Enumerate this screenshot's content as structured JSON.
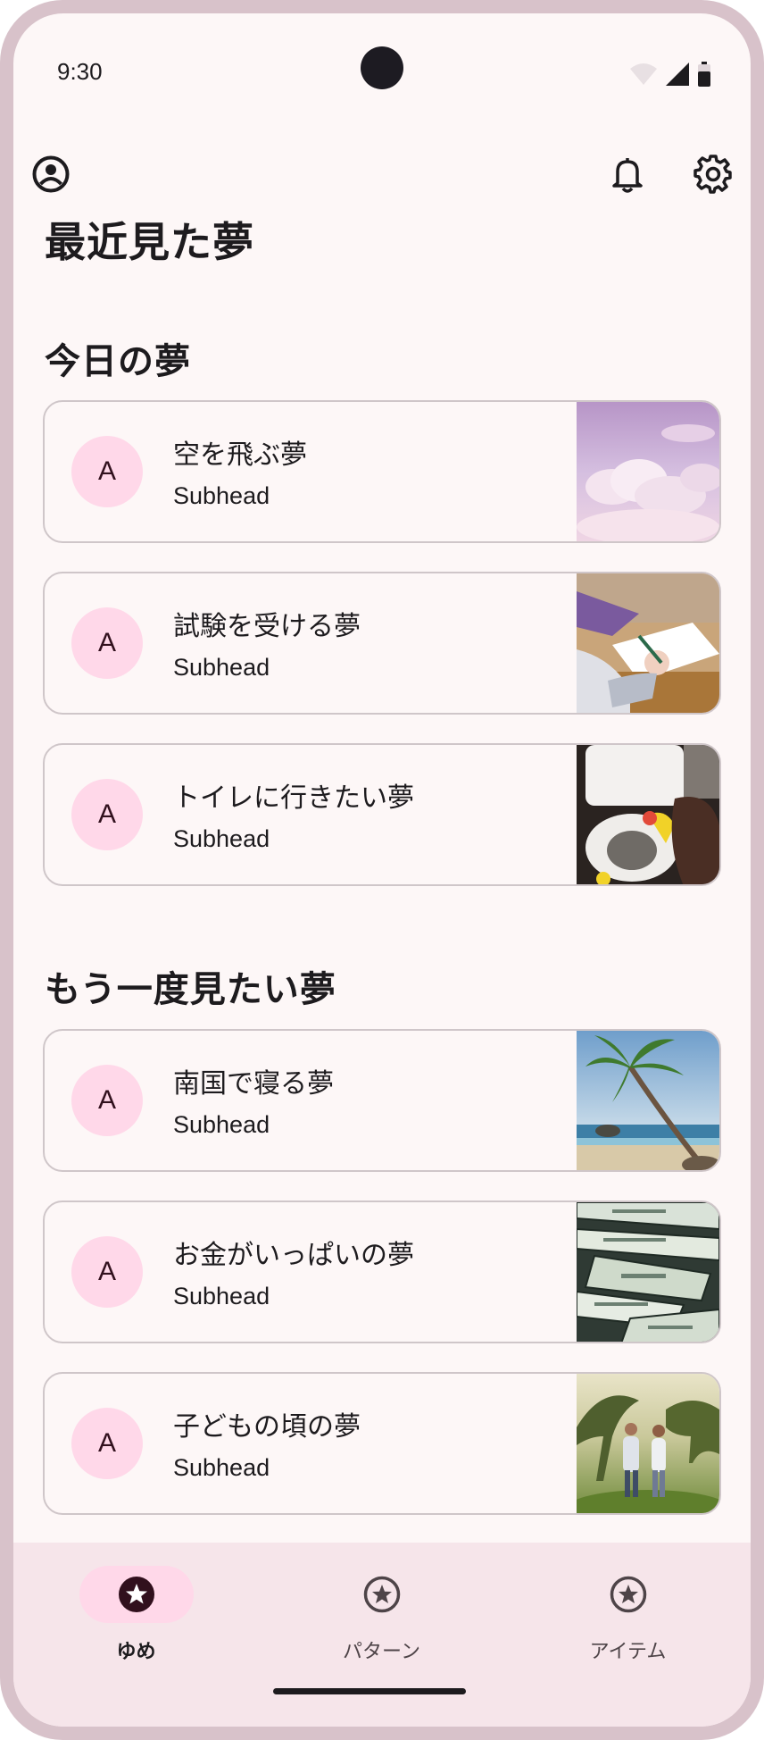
{
  "status_bar": {
    "time": "9:30"
  },
  "app_bar": {
    "account_icon": "account-circle-icon",
    "notifications_icon": "bell-icon",
    "settings_icon": "gear-icon"
  },
  "page_title": "最近見た夢",
  "sections": [
    {
      "title": "今日の夢",
      "items": [
        {
          "avatar": "A",
          "headline": "空を飛ぶ夢",
          "subhead": "Subhead",
          "image": "pink-clouds-sky"
        },
        {
          "avatar": "A",
          "headline": "試験を受ける夢",
          "subhead": "Subhead",
          "image": "person-writing-exam"
        },
        {
          "avatar": "A",
          "headline": "トイレに行きたい夢",
          "subhead": "Subhead",
          "image": "toilet-cleaning"
        }
      ]
    },
    {
      "title": "もう一度見たい夢",
      "items": [
        {
          "avatar": "A",
          "headline": "南国で寝る夢",
          "subhead": "Subhead",
          "image": "palm-tree-beach"
        },
        {
          "avatar": "A",
          "headline": "お金がいっぱいの夢",
          "subhead": "Subhead",
          "image": "dollar-bills"
        },
        {
          "avatar": "A",
          "headline": "子どもの頃の夢",
          "subhead": "Subhead",
          "image": "family-walking-field"
        }
      ]
    }
  ],
  "bottom_nav": [
    {
      "label": "ゆめ",
      "icon": "star-circle-icon",
      "active": true
    },
    {
      "label": "パターン",
      "icon": "star-circle-icon",
      "active": false
    },
    {
      "label": "アイテム",
      "icon": "star-circle-icon",
      "active": false
    }
  ],
  "colors": {
    "background": "#fdf7f7",
    "avatar_bg": "#ffd8e9",
    "nav_bg": "#f6e5ea",
    "nav_active_pill": "#ffd8e9",
    "card_border": "#cfc6c9",
    "frame": "#d8c2ca"
  }
}
